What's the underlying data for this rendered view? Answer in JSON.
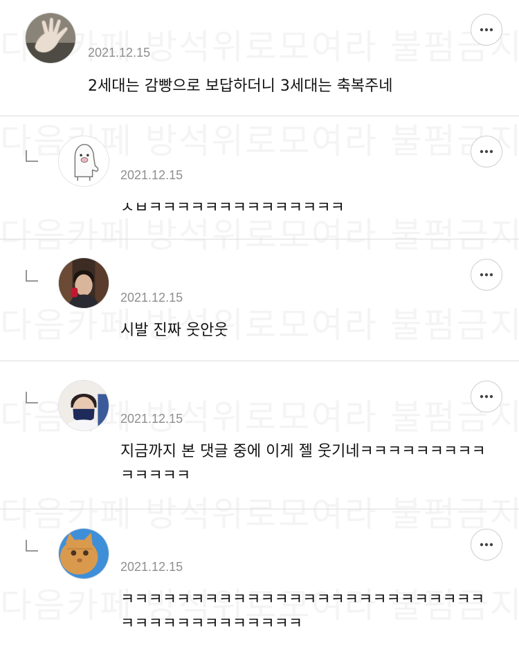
{
  "watermark": "다음카페 방석위로모여라 불펌금지",
  "more_icon": "more-horizontal-icon",
  "reply_icon": "reply-arrow-icon",
  "comments": [
    {
      "avatar": "hand-photo-avatar",
      "date": "2021.12.15",
      "text": "2세대는 감빵으로 보답하더니 3세대는 축복주네",
      "is_reply": false
    },
    {
      "avatar": "cartoon-character-avatar",
      "date": "2021.12.15",
      "text": "ㅅㅂㅋㅋㅋㅋㅋㅋㅋㅋㅋㅋㅋㅋㅋㅋ",
      "is_reply": true
    },
    {
      "avatar": "person-photo-avatar",
      "date": "2021.12.15",
      "text": "시발 진짜 웃안웃",
      "is_reply": true
    },
    {
      "avatar": "masked-person-avatar",
      "date": "2021.12.15",
      "text": "지금까지 본 댓글 중에 이게 젤 웃기네ㅋㅋㅋㅋㅋㅋㅋㅋㅋㅋㅋㅋㅋㅋ",
      "is_reply": true
    },
    {
      "avatar": "cat-photo-avatar",
      "date": "2021.12.15",
      "text": "ㅋㅋㅋㅋㅋㅋㅋㅋㅋㅋㅋㅋㅋㅋㅋㅋㅋㅋㅋㅋㅋㅋㅋㅋㅋㅋㅋㅋㅋㅋㅋㅋㅋㅋㅋㅋㅋㅋㅋ",
      "is_reply": true
    }
  ]
}
